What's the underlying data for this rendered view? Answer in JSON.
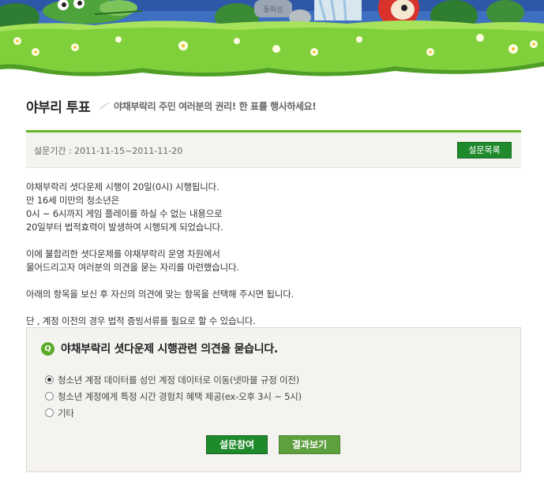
{
  "header": {
    "banner_sign": "동화섬"
  },
  "page": {
    "title": "야부리 투표",
    "subtitle": "야채부락리 주민 여러분의 권리! 한 표를 행사하세요!"
  },
  "period": {
    "text": "설문기간 : 2011-11-15~2011-11-20",
    "list_button": "설문목록"
  },
  "body": {
    "para1": [
      "야채부락리 셧다운제 시행이 20일(0시) 시행됩니다.",
      "만 16세 미만의 청소년은",
      "0시 ~ 6시까지 게임 플레이를 하실 수 없는 내용으로",
      "20일부터 법적효력이 발생하여 시행되게 되었습니다."
    ],
    "para2": [
      "이에 불합리한 셧다운제를 야채부락리 운영 차원에서",
      "물어드리고자 여러분의 의견을 묻는 자리를 마련했습니다."
    ],
    "para3": "아래의 항목을 보신 후 자신의 의견에 맞는 항목을 선택해 주시면 됩니다.",
    "para4": "단 , 계정  이전의 경우 법적 증빙서류를 필요로 할 수 있습니다."
  },
  "question": {
    "badge": "Q",
    "title": "야채부락리 셧다운제 시행관련 의견을 묻습니다.",
    "options": [
      {
        "label": "청소년 계정 데이터를 성인 계정 데이터로 이동(넷마블 규정 이전)",
        "selected": true
      },
      {
        "label": "청소년 계정에게 특정 시간 경험치 혜택 제공(ex-오후 3시 ~ 5시)",
        "selected": false
      },
      {
        "label": "기타",
        "selected": false
      }
    ],
    "vote_button": "설문참여",
    "result_button": "결과보기"
  },
  "colors": {
    "accent_green": "#67b52a",
    "button_green": "#1e8a2b",
    "panel_bg": "#f5f3f0"
  }
}
